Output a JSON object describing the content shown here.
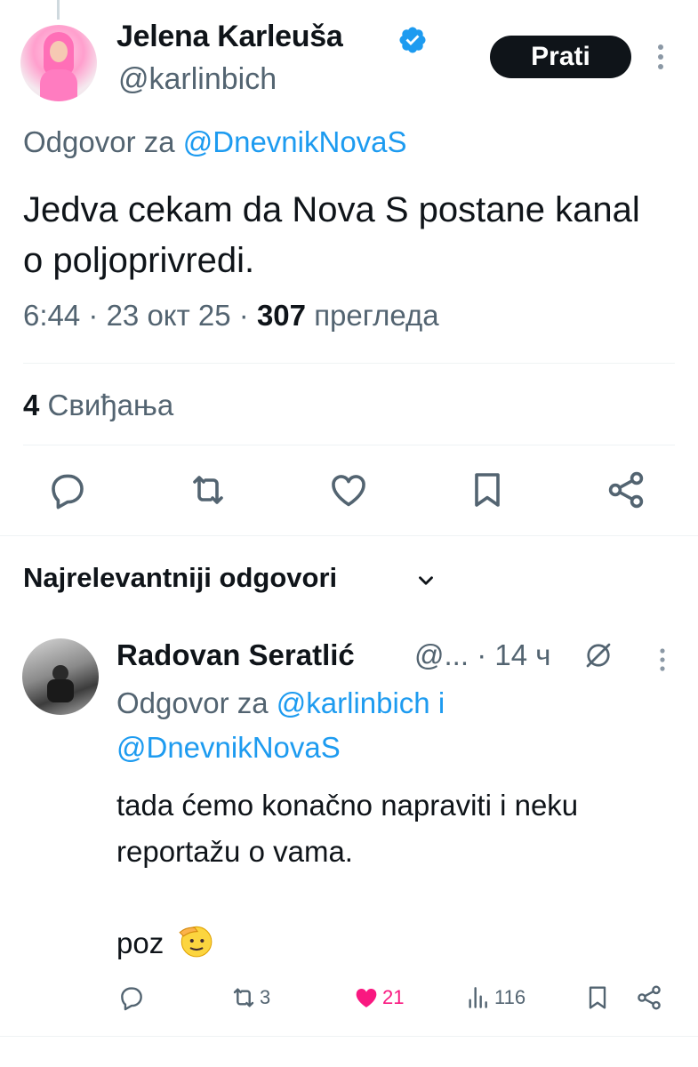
{
  "main_tweet": {
    "author_name": "Jelena Karleuša",
    "handle": "@karlinbich",
    "follow_label": "Prati",
    "reply_prefix": "Odgovor za",
    "reply_mention": "@DnevnikNovaS",
    "text": "Jedva cekam da Nova S postane kanal o poljoprivredi.",
    "time": "6:44",
    "date": "23 окт 25",
    "separator": "·",
    "views_count": "307",
    "views_label": "прегледа",
    "likes_count": "4",
    "likes_label": "Свиђања"
  },
  "replies_header": {
    "label": "Najrelevantniji odgovori"
  },
  "reply": {
    "author_name": "Radovan Seratlić",
    "handle": "@...",
    "separator": "·",
    "age": "14 ч",
    "reply_prefix": "Odgovor za",
    "reply_mention_1": "@karlinbich",
    "reply_joiner": "i",
    "reply_mention_2": "@DnevnikNovaS",
    "text_line1": "tada ćemo konačno napraviti i neku reportažu o vama.",
    "text_line2": "poz",
    "retweets": "3",
    "likes": "21",
    "views": "116"
  },
  "colors": {
    "accent": "#1d9bf0",
    "text": "#0f1419",
    "secondary": "#536471",
    "like": "#f91880",
    "divider": "#eff3f4"
  },
  "icons": [
    "verified-badge-icon",
    "more-icon",
    "reply-icon",
    "retweet-icon",
    "like-icon",
    "bookmark-icon",
    "share-icon",
    "chevron-down-icon",
    "grok-icon",
    "views-icon",
    "salute-emoji-icon"
  ]
}
